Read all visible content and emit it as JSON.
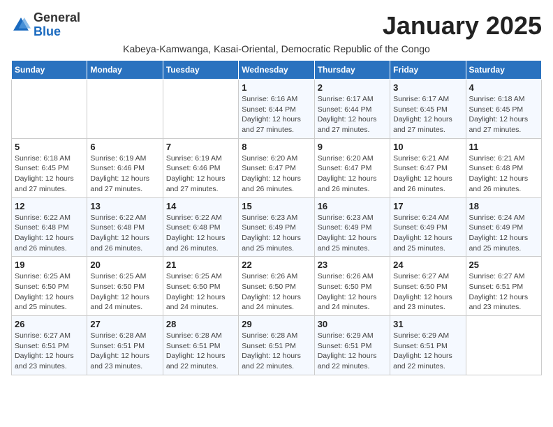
{
  "header": {
    "logo_general": "General",
    "logo_blue": "Blue",
    "month_title": "January 2025",
    "subtitle": "Kabeya-Kamwanga, Kasai-Oriental, Democratic Republic of the Congo"
  },
  "days_of_week": [
    "Sunday",
    "Monday",
    "Tuesday",
    "Wednesday",
    "Thursday",
    "Friday",
    "Saturday"
  ],
  "weeks": [
    [
      {
        "day": "",
        "info": ""
      },
      {
        "day": "",
        "info": ""
      },
      {
        "day": "",
        "info": ""
      },
      {
        "day": "1",
        "info": "Sunrise: 6:16 AM\nSunset: 6:44 PM\nDaylight: 12 hours and 27 minutes."
      },
      {
        "day": "2",
        "info": "Sunrise: 6:17 AM\nSunset: 6:44 PM\nDaylight: 12 hours and 27 minutes."
      },
      {
        "day": "3",
        "info": "Sunrise: 6:17 AM\nSunset: 6:45 PM\nDaylight: 12 hours and 27 minutes."
      },
      {
        "day": "4",
        "info": "Sunrise: 6:18 AM\nSunset: 6:45 PM\nDaylight: 12 hours and 27 minutes."
      }
    ],
    [
      {
        "day": "5",
        "info": "Sunrise: 6:18 AM\nSunset: 6:45 PM\nDaylight: 12 hours and 27 minutes."
      },
      {
        "day": "6",
        "info": "Sunrise: 6:19 AM\nSunset: 6:46 PM\nDaylight: 12 hours and 27 minutes."
      },
      {
        "day": "7",
        "info": "Sunrise: 6:19 AM\nSunset: 6:46 PM\nDaylight: 12 hours and 27 minutes."
      },
      {
        "day": "8",
        "info": "Sunrise: 6:20 AM\nSunset: 6:47 PM\nDaylight: 12 hours and 26 minutes."
      },
      {
        "day": "9",
        "info": "Sunrise: 6:20 AM\nSunset: 6:47 PM\nDaylight: 12 hours and 26 minutes."
      },
      {
        "day": "10",
        "info": "Sunrise: 6:21 AM\nSunset: 6:47 PM\nDaylight: 12 hours and 26 minutes."
      },
      {
        "day": "11",
        "info": "Sunrise: 6:21 AM\nSunset: 6:48 PM\nDaylight: 12 hours and 26 minutes."
      }
    ],
    [
      {
        "day": "12",
        "info": "Sunrise: 6:22 AM\nSunset: 6:48 PM\nDaylight: 12 hours and 26 minutes."
      },
      {
        "day": "13",
        "info": "Sunrise: 6:22 AM\nSunset: 6:48 PM\nDaylight: 12 hours and 26 minutes."
      },
      {
        "day": "14",
        "info": "Sunrise: 6:22 AM\nSunset: 6:48 PM\nDaylight: 12 hours and 26 minutes."
      },
      {
        "day": "15",
        "info": "Sunrise: 6:23 AM\nSunset: 6:49 PM\nDaylight: 12 hours and 25 minutes."
      },
      {
        "day": "16",
        "info": "Sunrise: 6:23 AM\nSunset: 6:49 PM\nDaylight: 12 hours and 25 minutes."
      },
      {
        "day": "17",
        "info": "Sunrise: 6:24 AM\nSunset: 6:49 PM\nDaylight: 12 hours and 25 minutes."
      },
      {
        "day": "18",
        "info": "Sunrise: 6:24 AM\nSunset: 6:49 PM\nDaylight: 12 hours and 25 minutes."
      }
    ],
    [
      {
        "day": "19",
        "info": "Sunrise: 6:25 AM\nSunset: 6:50 PM\nDaylight: 12 hours and 25 minutes."
      },
      {
        "day": "20",
        "info": "Sunrise: 6:25 AM\nSunset: 6:50 PM\nDaylight: 12 hours and 24 minutes."
      },
      {
        "day": "21",
        "info": "Sunrise: 6:25 AM\nSunset: 6:50 PM\nDaylight: 12 hours and 24 minutes."
      },
      {
        "day": "22",
        "info": "Sunrise: 6:26 AM\nSunset: 6:50 PM\nDaylight: 12 hours and 24 minutes."
      },
      {
        "day": "23",
        "info": "Sunrise: 6:26 AM\nSunset: 6:50 PM\nDaylight: 12 hours and 24 minutes."
      },
      {
        "day": "24",
        "info": "Sunrise: 6:27 AM\nSunset: 6:50 PM\nDaylight: 12 hours and 23 minutes."
      },
      {
        "day": "25",
        "info": "Sunrise: 6:27 AM\nSunset: 6:51 PM\nDaylight: 12 hours and 23 minutes."
      }
    ],
    [
      {
        "day": "26",
        "info": "Sunrise: 6:27 AM\nSunset: 6:51 PM\nDaylight: 12 hours and 23 minutes."
      },
      {
        "day": "27",
        "info": "Sunrise: 6:28 AM\nSunset: 6:51 PM\nDaylight: 12 hours and 23 minutes."
      },
      {
        "day": "28",
        "info": "Sunrise: 6:28 AM\nSunset: 6:51 PM\nDaylight: 12 hours and 22 minutes."
      },
      {
        "day": "29",
        "info": "Sunrise: 6:28 AM\nSunset: 6:51 PM\nDaylight: 12 hours and 22 minutes."
      },
      {
        "day": "30",
        "info": "Sunrise: 6:29 AM\nSunset: 6:51 PM\nDaylight: 12 hours and 22 minutes."
      },
      {
        "day": "31",
        "info": "Sunrise: 6:29 AM\nSunset: 6:51 PM\nDaylight: 12 hours and 22 minutes."
      },
      {
        "day": "",
        "info": ""
      }
    ]
  ]
}
